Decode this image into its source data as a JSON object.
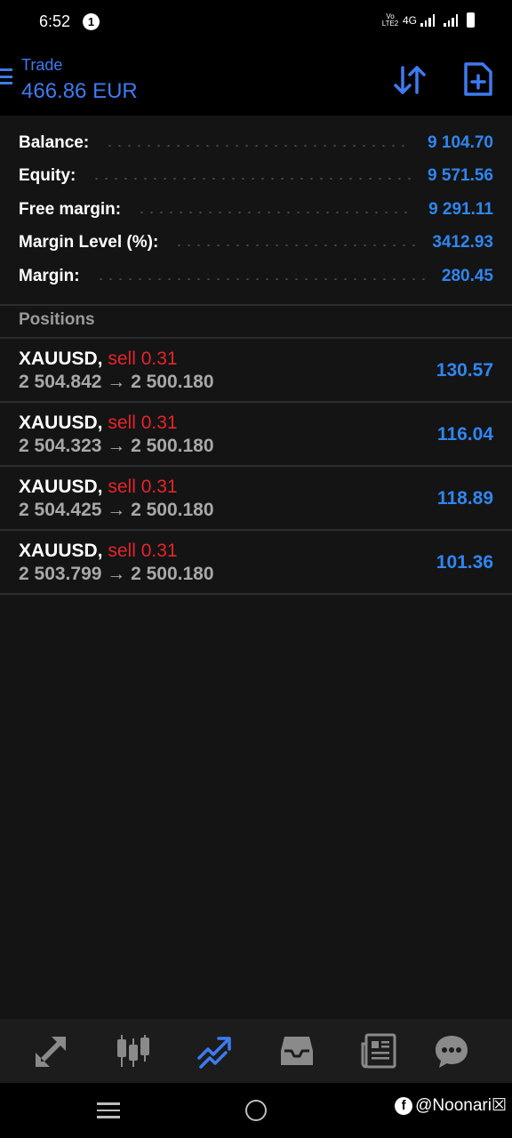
{
  "status_bar": {
    "time": "6:52",
    "notification_count": "1",
    "volte": "Vo LTE2",
    "network": "4G"
  },
  "header": {
    "title": "Trade",
    "subtitle": "466.86 EUR",
    "accent_color": "#3d7bf0"
  },
  "summary": [
    {
      "label": "Balance:",
      "value": "9 104.70"
    },
    {
      "label": "Equity:",
      "value": "9 571.56"
    },
    {
      "label": "Free margin:",
      "value": "9 291.11"
    },
    {
      "label": "Margin Level (%):",
      "value": "3412.93"
    },
    {
      "label": "Margin:",
      "value": "280.45"
    }
  ],
  "positions_label": "Positions",
  "positions": [
    {
      "symbol": "XAUUSD,",
      "side": "sell 0.31",
      "prices": "2 504.842 → 2 500.180",
      "profit": "130.57"
    },
    {
      "symbol": "XAUUSD,",
      "side": "sell 0.31",
      "prices": "2 504.323 → 2 500.180",
      "profit": "116.04"
    },
    {
      "symbol": "XAUUSD,",
      "side": "sell 0.31",
      "prices": "2 504.425 → 2 500.180",
      "profit": "118.89"
    },
    {
      "symbol": "XAUUSD,",
      "side": "sell 0.31",
      "prices": "2 503.799 → 2 500.180",
      "profit": "101.36"
    }
  ],
  "tabs": [
    {
      "icon": "quotes-icon",
      "active": false
    },
    {
      "icon": "chart-icon",
      "active": false
    },
    {
      "icon": "trade-icon",
      "active": true
    },
    {
      "icon": "history-icon",
      "active": false
    },
    {
      "icon": "news-icon",
      "active": false
    },
    {
      "icon": "messages-icon",
      "active": false
    }
  ],
  "watermark": "@Noonari☒",
  "colors": {
    "profit": "#2f86f0",
    "sell": "#e5242a",
    "background": "#141414"
  }
}
